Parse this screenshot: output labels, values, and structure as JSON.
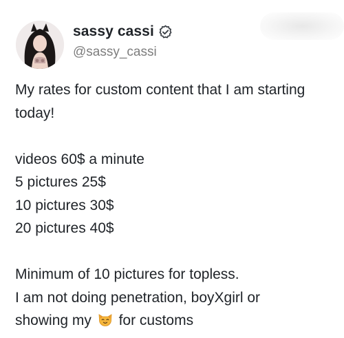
{
  "profile": {
    "display_name": "sassy cassi",
    "handle": "@sassy_cassi",
    "verified_icon": "verified-badge-icon",
    "avatar": "profile-photo"
  },
  "post": {
    "lines": [
      "My rates for custom content that I am starting",
      "today!",
      "",
      "videos 60$ a minute",
      "5 pictures 25$",
      "10 pictures 30$",
      "20 pictures 40$",
      "",
      "Minimum of 10 pictures for topless.",
      "I am not doing penetration, boyXgirl or"
    ],
    "last_line_before": "showing my",
    "last_line_emoji": "cat-face-emoji",
    "last_line_after": "for customs"
  }
}
